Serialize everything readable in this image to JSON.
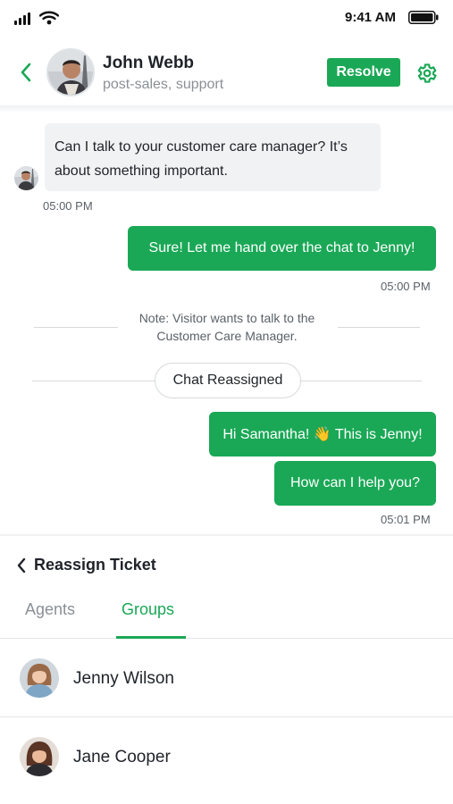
{
  "status_bar": {
    "time": "9:41 AM"
  },
  "header": {
    "contact_name": "John Webb",
    "contact_tags": "post-sales, support",
    "resolve_label": "Resolve"
  },
  "messages": {
    "incoming_1": {
      "text": "Can I talk to your customer care manager? It’s about something important.",
      "time": "05:00 PM"
    },
    "outgoing_1": {
      "text": "Sure! Let me hand over the chat to Jenny!",
      "time": "05:00 PM"
    },
    "note": "Note: Visitor wants to talk to the Customer Care Manager.",
    "event": "Chat Reassigned",
    "outgoing_2": {
      "text": "Hi Samantha! 👋 This is Jenny!"
    },
    "outgoing_3": {
      "text": "How can I help you?",
      "time": "05:01 PM"
    }
  },
  "reassign": {
    "title": "Reassign Ticket",
    "tabs": [
      {
        "label": "Agents",
        "active": false
      },
      {
        "label": "Groups",
        "active": true
      }
    ],
    "people": [
      {
        "name": "Jenny Wilson"
      },
      {
        "name": "Jane Cooper"
      }
    ]
  },
  "colors": {
    "accent": "#1aa856",
    "bubble_incoming": "#f1f2f4",
    "text_primary": "#1f2329",
    "text_muted": "#8a9097"
  },
  "icons": [
    "signal-icon",
    "wifi-icon",
    "battery-icon",
    "back-arrow-icon",
    "gear-icon",
    "chevron-left-icon"
  ]
}
